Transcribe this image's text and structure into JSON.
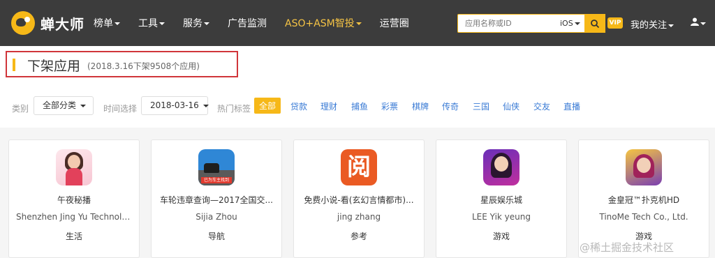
{
  "brand": {
    "name": "蝉大师"
  },
  "nav": {
    "items": [
      {
        "label": "榜单",
        "caret": true,
        "highlight": false
      },
      {
        "label": "工具",
        "caret": true,
        "highlight": false
      },
      {
        "label": "服务",
        "caret": true,
        "highlight": false
      },
      {
        "label": "广告监测",
        "caret": false,
        "highlight": false
      },
      {
        "label": "ASO+ASM智投",
        "caret": true,
        "highlight": true
      },
      {
        "label": "运营圈",
        "caret": false,
        "highlight": false
      }
    ],
    "search": {
      "placeholder": "应用名称或ID",
      "platform": "iOS"
    },
    "vip": "VIP",
    "follow": "我的关注"
  },
  "page": {
    "title": "下架应用",
    "subtitle": "(2018.3.16下架9508个应用)"
  },
  "filters": {
    "category_label": "类别",
    "category_value": "全部分类",
    "time_label": "时间选择",
    "time_value": "2018-03-16",
    "tags_label": "热门标签",
    "tags": [
      "全部",
      "贷款",
      "理财",
      "捕鱼",
      "彩票",
      "棋牌",
      "传奇",
      "三国",
      "仙侠",
      "交友",
      "直播"
    ]
  },
  "apps": [
    {
      "name": "午夜秘播",
      "developer": "Shenzhen Jing Yu Technology ...",
      "category": "生活",
      "icon": "app-icon-girl"
    },
    {
      "name": "车轮违章查询—2017全国交...",
      "developer": "Sijia Zhou",
      "category": "导航",
      "icon": "app-icon-car",
      "icon_badge": "已为车主找到"
    },
    {
      "name": "免费小说-看(玄幻言情都市)...",
      "developer": "jing zhang",
      "category": "参考",
      "icon": "app-icon-book",
      "icon_glyph": "阅"
    },
    {
      "name": "星辰娱乐城",
      "developer": "LEE Yik yeung",
      "category": "游戏",
      "icon": "app-icon-casino"
    },
    {
      "name": "金皇冠™扑克机HD",
      "developer": "TinoMe Tech Co., Ltd.",
      "category": "游戏",
      "icon": "app-icon-poker"
    }
  ],
  "watermark": "@稀土掘金技术社区",
  "colors": {
    "accent": "#f6b818",
    "topbar": "#3c3c3c",
    "link": "#3a7bd5",
    "highlight_box": "#d0353a"
  }
}
